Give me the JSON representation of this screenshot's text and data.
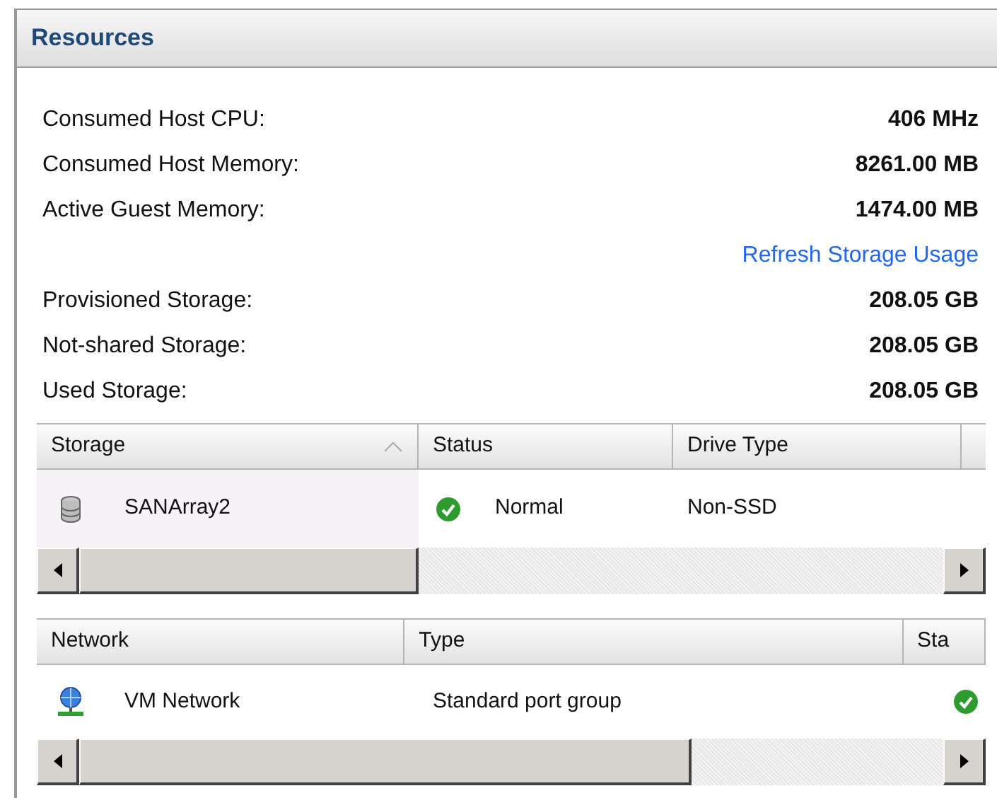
{
  "panel": {
    "title": "Resources"
  },
  "stats": [
    {
      "kind": "stat",
      "label": "Consumed Host CPU:",
      "value": "406 MHz"
    },
    {
      "kind": "stat",
      "label": "Consumed Host Memory:",
      "value": "8261.00 MB"
    },
    {
      "kind": "stat",
      "label": "Active Guest Memory:",
      "value": "1474.00 MB"
    },
    {
      "kind": "link",
      "label": "Refresh Storage Usage"
    },
    {
      "kind": "stat",
      "label": "Provisioned Storage:",
      "value": "208.05 GB"
    },
    {
      "kind": "stat",
      "label": "Not-shared Storage:",
      "value": "208.05 GB"
    },
    {
      "kind": "stat",
      "label": "Used Storage:",
      "value": "208.05 GB"
    }
  ],
  "storage_table": {
    "columns": [
      {
        "label": "Storage",
        "sorted": true
      },
      {
        "label": "Status",
        "sorted": false
      },
      {
        "label": "Drive Type",
        "sorted": false
      }
    ],
    "rows": [
      {
        "name": "SANArray2",
        "status": "Normal",
        "drive_type": "Non-SSD"
      }
    ]
  },
  "network_table": {
    "columns": [
      {
        "label": "Network",
        "sorted": false
      },
      {
        "label": "Type",
        "sorted": false
      },
      {
        "label": "Sta",
        "sorted": false
      }
    ],
    "rows": [
      {
        "name": "VM Network",
        "type": "Standard port group"
      }
    ]
  }
}
